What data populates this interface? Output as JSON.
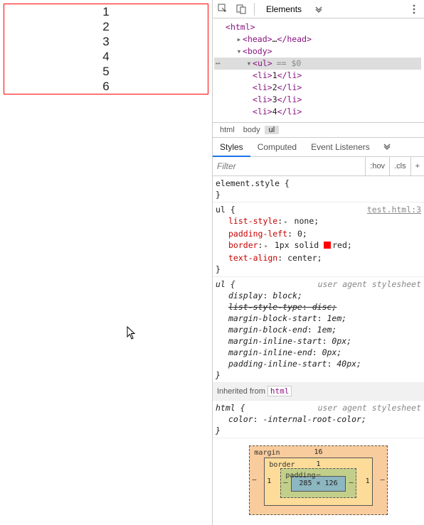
{
  "page": {
    "items": [
      "1",
      "2",
      "3",
      "4",
      "5",
      "6"
    ]
  },
  "toolbar": {
    "tab_elements": "Elements"
  },
  "dom": {
    "html": "html",
    "head": "head",
    "head_ellipsis": "…",
    "body": "body",
    "ul": "ul",
    "eq0": "== $0",
    "li": "li",
    "li_values": [
      "1",
      "2",
      "3",
      "4"
    ]
  },
  "crumbs": {
    "html": "html",
    "body": "body",
    "ul": "ul"
  },
  "styles_tabs": {
    "styles": "Styles",
    "computed": "Computed",
    "listeners": "Event Listeners"
  },
  "filter": {
    "placeholder": "Filter",
    "hov": ":hov",
    "cls": ".cls",
    "plus": "+"
  },
  "rules": {
    "element_style": "element.style {",
    "close": "}",
    "ul_sel": "ul {",
    "ul_src": "test.html:3",
    "list_style_p": "list-style",
    "list_style_v": "none;",
    "padding_left_p": "padding-left",
    "padding_left_v": "0;",
    "border_p": "border",
    "border_v1": "1px solid ",
    "border_v2": "red;",
    "text_align_p": "text-align",
    "text_align_v": "center;",
    "ua_src": "user agent stylesheet",
    "display_p": "display",
    "display_v": "block;",
    "lst_p": "list-style-type",
    "lst_v": "disc;",
    "mbs_p": "margin-block-start",
    "mbs_v": "1em;",
    "mbe_p": "margin-block-end",
    "mbe_v": "1em;",
    "mis_p": "margin-inline-start",
    "mis_v": "0px;",
    "mie_p": "margin-inline-end",
    "mie_v": "0px;",
    "pis_p": "padding-inline-start",
    "pis_v": "40px;",
    "inherited_label": "Inherited from ",
    "inherited_chip": "html",
    "html_sel": "html {",
    "color_p": "color",
    "color_v": "-internal-root-color;"
  },
  "box": {
    "margin_label": "margin",
    "margin_top": "16",
    "border_label": "border",
    "border_top": "1",
    "padding_label": "padding",
    "padding_top": "–",
    "content": "285 × 126",
    "dash": "–",
    "one": "1"
  }
}
